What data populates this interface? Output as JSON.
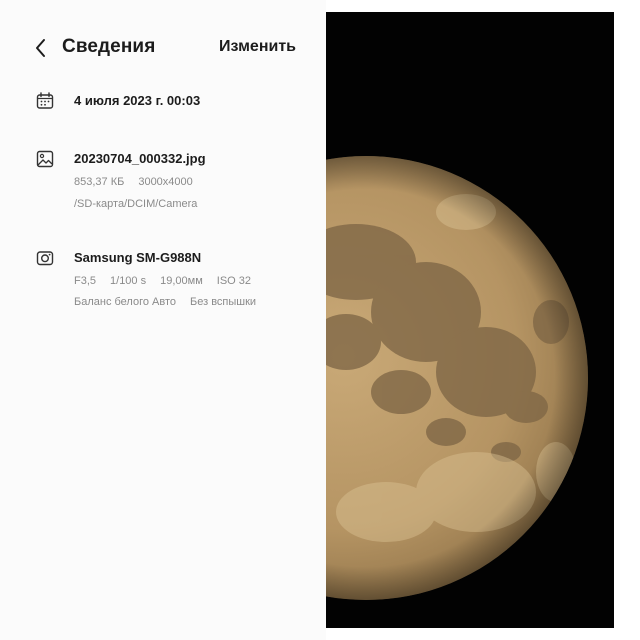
{
  "header": {
    "title": "Сведения",
    "edit_label": "Изменить",
    "back_icon": "chevron-left-icon"
  },
  "details": {
    "date": {
      "icon": "calendar-icon",
      "value": "4 июля 2023 г. 00:03"
    },
    "file": {
      "icon": "image-icon",
      "name": "20230704_000332.jpg",
      "size": "853,37 КБ",
      "resolution": "3000x4000",
      "path": "/SD-карта/DCIM/Camera"
    },
    "camera": {
      "icon": "camera-icon",
      "model": "Samsung SM-G988N",
      "aperture": "F3,5",
      "shutter": "1/100 s",
      "focal_length": "19,00мм",
      "iso": "ISO 32",
      "white_balance": "Баланс белого Авто",
      "flash": "Без вспышки"
    }
  },
  "photo": {
    "subject": "full moon",
    "background_color": "#020202",
    "moon_color": "#b79766"
  }
}
